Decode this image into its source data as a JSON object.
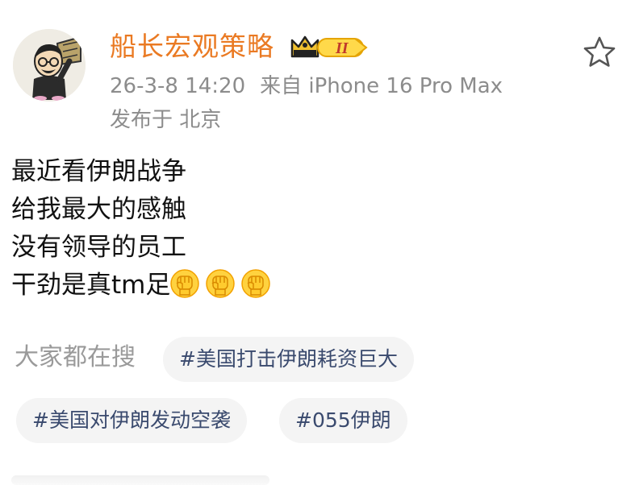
{
  "user": {
    "name": "船长宏观策略",
    "badge_level": "II",
    "avatar_icon": "cartoon-avatar-icon",
    "badge_icon": "crown-badge-icon",
    "name_color": "#ea7a23"
  },
  "meta": {
    "time": "26-3-8 14:20",
    "source": "来自 iPhone 16 Pro Max",
    "location": "发布于 北京"
  },
  "post": {
    "lines": [
      "最近看伊朗战争",
      "给我最大的感触",
      "没有领导的员工",
      "干劲是真tm足"
    ],
    "emoji_icon": "raised-fist-icon"
  },
  "search": {
    "label": "大家都在搜",
    "topics": [
      "#美国打击伊朗耗资巨大",
      "#美国对伊朗发动空袭",
      "#055伊朗"
    ]
  },
  "actions": {
    "favorite_icon": "star-icon"
  }
}
